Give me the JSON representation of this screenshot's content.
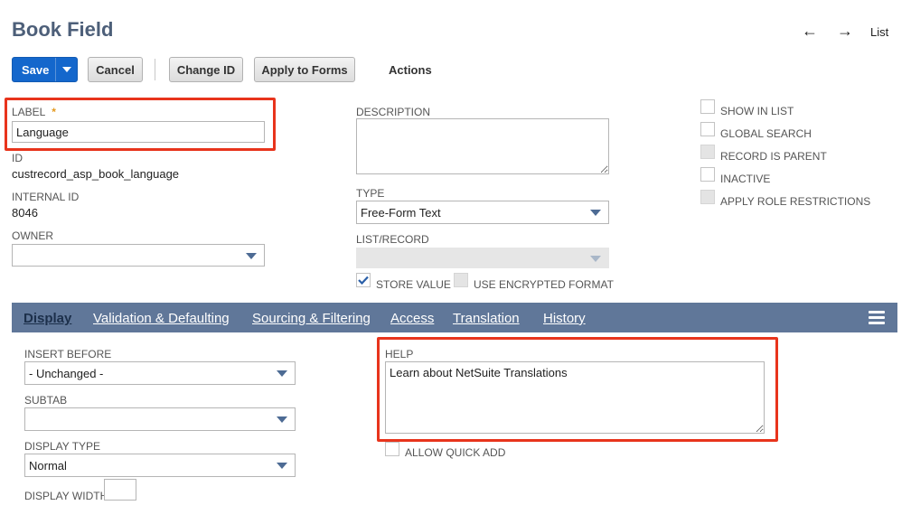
{
  "page": {
    "title": "Book Field"
  },
  "nav": {
    "back_icon": "←",
    "forward_icon": "→",
    "list_label": "List"
  },
  "toolbar": {
    "save_label": "Save",
    "cancel_label": "Cancel",
    "change_id_label": "Change ID",
    "apply_to_forms_label": "Apply to Forms",
    "actions_label": "Actions"
  },
  "fields": {
    "label": {
      "label": "LABEL",
      "required_marker": "*",
      "value": "Language"
    },
    "id": {
      "label": "ID",
      "value": "custrecord_asp_book_language"
    },
    "internal_id": {
      "label": "INTERNAL ID",
      "value": "8046"
    },
    "owner": {
      "label": "OWNER",
      "value": ""
    },
    "description": {
      "label": "DESCRIPTION",
      "value": ""
    },
    "type": {
      "label": "TYPE",
      "value": "Free-Form Text"
    },
    "list_record": {
      "label": "LIST/RECORD",
      "value": ""
    },
    "store_value": {
      "label": "STORE VALUE",
      "checked": true
    },
    "use_encrypted_format": {
      "label": "USE ENCRYPTED FORMAT",
      "checked": false
    }
  },
  "options": [
    {
      "label": "SHOW IN LIST",
      "checked": false,
      "disabled": false
    },
    {
      "label": "GLOBAL SEARCH",
      "checked": false,
      "disabled": false
    },
    {
      "label": "RECORD IS PARENT",
      "checked": false,
      "disabled": true
    },
    {
      "label": "INACTIVE",
      "checked": false,
      "disabled": false
    },
    {
      "label": "APPLY ROLE RESTRICTIONS",
      "checked": false,
      "disabled": true
    }
  ],
  "tabs": [
    {
      "label": "Display",
      "active": true
    },
    {
      "label": "Validation & Defaulting",
      "active": false
    },
    {
      "label": "Sourcing & Filtering",
      "active": false
    },
    {
      "label": "Access",
      "active": false
    },
    {
      "label": "Translation",
      "active": false
    },
    {
      "label": "History",
      "active": false
    }
  ],
  "display": {
    "insert_before": {
      "label": "INSERT BEFORE",
      "value": "- Unchanged -"
    },
    "subtab": {
      "label": "SUBTAB",
      "value": ""
    },
    "display_type": {
      "label": "DISPLAY TYPE",
      "value": "Normal"
    },
    "display_width": {
      "label": "DISPLAY WIDTH",
      "value": ""
    },
    "help": {
      "label": "HELP",
      "value": "Learn about NetSuite Translations"
    },
    "allow_quick_add": {
      "label": "ALLOW QUICK ADD",
      "checked": false
    }
  },
  "colors": {
    "title": "#4d5f79",
    "primary_button": "#1467cc",
    "tab_bar": "#607799",
    "highlight": "#e8341c"
  }
}
